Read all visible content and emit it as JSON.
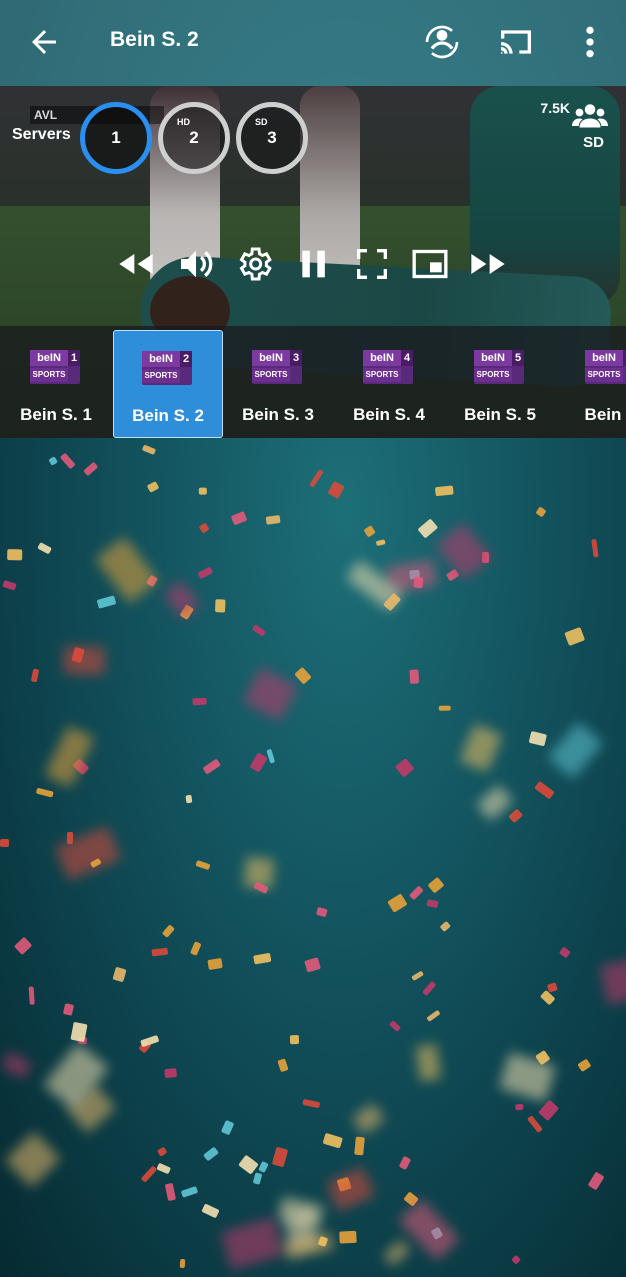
{
  "appbar": {
    "title": "Bein S. 2",
    "back_icon": "arrow-left-icon",
    "icons": [
      "account-switch-icon",
      "cast-icon",
      "more-vertical-icon"
    ]
  },
  "player": {
    "servers_label": "Servers",
    "servers": [
      {
        "tag": "",
        "number": "1",
        "active": true
      },
      {
        "tag": "HD",
        "number": "2",
        "active": false
      },
      {
        "tag": "SD",
        "number": "3",
        "active": false
      }
    ],
    "viewers": "7.5K",
    "quality": "SD",
    "scoreboard": "AVL",
    "controls": [
      "rewind-icon",
      "volume-icon",
      "settings-icon",
      "pause-icon",
      "fullscreen-icon",
      "picture-in-picture-icon",
      "fast-forward-icon"
    ]
  },
  "channels": [
    {
      "label": "Bein S. 1",
      "num": "1",
      "active": false
    },
    {
      "label": "Bein S. 2",
      "num": "2",
      "active": true
    },
    {
      "label": "Bein S. 3",
      "num": "3",
      "active": false
    },
    {
      "label": "Bein S. 4",
      "num": "4",
      "active": false
    },
    {
      "label": "Bein S. 5",
      "num": "5",
      "active": false
    },
    {
      "label": "Bein S",
      "num": "",
      "active": false
    }
  ],
  "logo_text": {
    "brand": "beIN",
    "sub": "SPORTS"
  },
  "colors": {
    "accent": "#2f8ed9",
    "server_active": "#2a8ff0",
    "brand_purple": "#7c3aa1"
  }
}
